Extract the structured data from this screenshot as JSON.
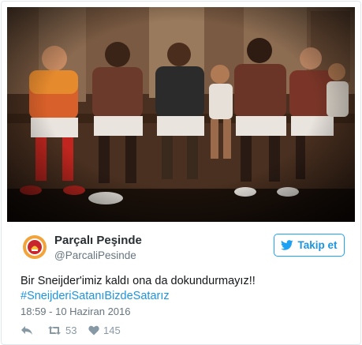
{
  "user": {
    "display_name": "Parçalı Peşinde",
    "handle": "@ParcaliPesinde",
    "avatar_icon": "galatasaray-crest-icon"
  },
  "follow_button": {
    "label": "Takip et",
    "icon": "twitter-bird-icon",
    "color": "#1da1f2"
  },
  "tweet": {
    "text": "Bir Sneijder'imiz kaldı ona da dokundurmayız!!",
    "hashtag": "#SneijderiSatanıBizdeSatarız",
    "timestamp": "18:59 - 10 Haziran 2016"
  },
  "actions": {
    "reply_icon": "reply-icon",
    "retweet_icon": "retweet-icon",
    "retweet_count": "53",
    "like_icon": "heart-icon",
    "like_count": "145"
  }
}
